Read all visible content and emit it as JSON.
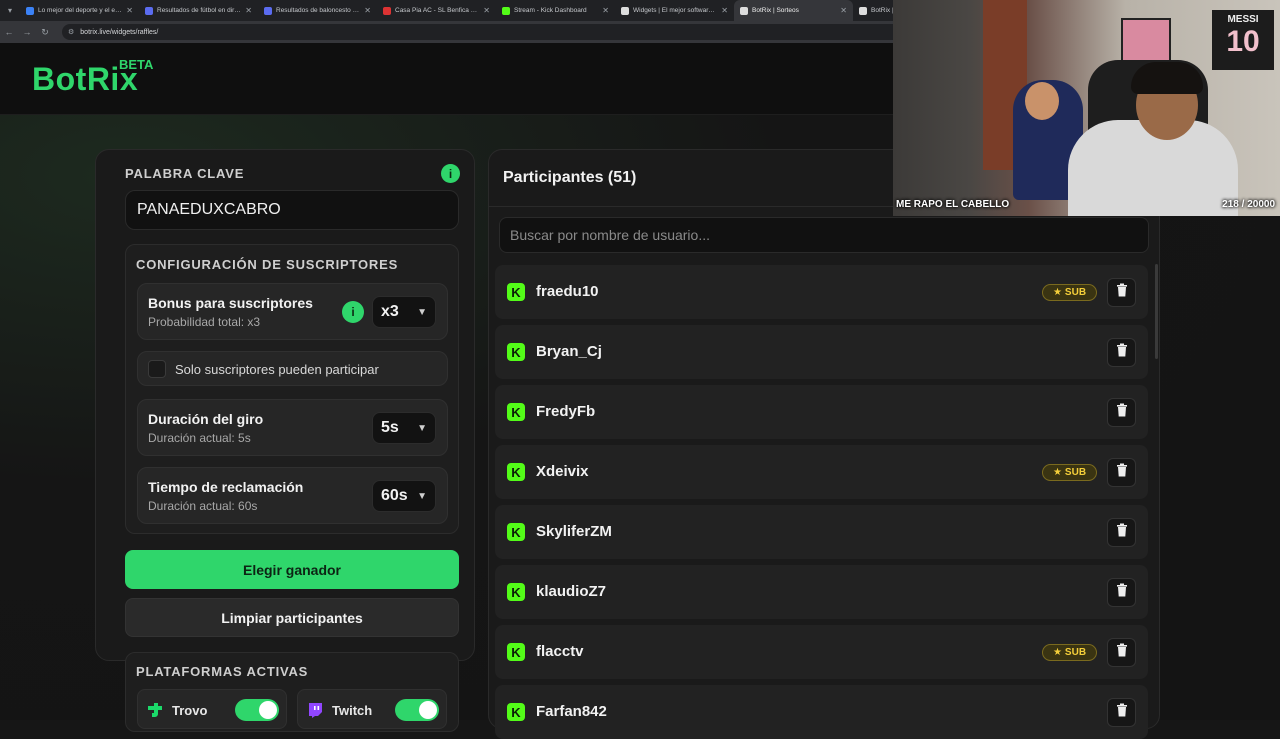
{
  "browser": {
    "tabs": [
      {
        "title": "Lo mejor del deporte y el entre",
        "color": "#3b82f6"
      },
      {
        "title": "Resultados de fútbol en direct",
        "color": "#5b6cf0"
      },
      {
        "title": "Resultados de baloncesto en di",
        "color": "#5b6cf0"
      },
      {
        "title": "Casa Pia AC - SL Benfica Cuota",
        "color": "#d33"
      },
      {
        "title": "Stream - Kick Dashboard",
        "color": "#53fc18"
      },
      {
        "title": "Widgets | El mejor software pa",
        "color": "#ddd"
      },
      {
        "title": "BotRix | Sorteos",
        "color": "#ddd"
      },
      {
        "title": "BotRix | S",
        "color": "#ddd"
      }
    ],
    "url": "botrix.live/widgets/raffles/"
  },
  "header": {
    "logo": "BotRix",
    "badge": "BETA"
  },
  "raffle": {
    "keyword_label": "PALABRA CLAVE",
    "keyword_value": "PANAEDUXCABRO",
    "subs_config_title": "CONFIGURACIÓN DE SUSCRIPTORES",
    "bonus_title": "Bonus para suscriptores",
    "bonus_sub": "Probabilidad total: x3",
    "bonus_value": "x3",
    "only_subs_label": "Solo suscriptores pueden participar",
    "spin_title": "Duración del giro",
    "spin_sub": "Duración actual: 5s",
    "spin_value": "5s",
    "claim_title": "Tiempo de reclamación",
    "claim_sub": "Duración actual: 60s",
    "claim_value": "60s",
    "pick_winner": "Elegir ganador",
    "clear": "Limpiar participantes",
    "platforms_title": "PLATAFORMAS ACTIVAS",
    "platforms": [
      {
        "name": "Trovo",
        "enabled": true,
        "color": "#1bd96a"
      },
      {
        "name": "Twitch",
        "enabled": true,
        "color": "#9146ff"
      }
    ]
  },
  "participants": {
    "title": "Participantes (51)",
    "search_placeholder": "Buscar por nombre de usuario...",
    "sub_badge": "SUB",
    "list": [
      {
        "name": "fraedu10",
        "sub": true
      },
      {
        "name": "Bryan_Cj",
        "sub": false
      },
      {
        "name": "FredyFb",
        "sub": false
      },
      {
        "name": "Xdeivix",
        "sub": true
      },
      {
        "name": "SkyliferZM",
        "sub": false
      },
      {
        "name": "klaudioZ7",
        "sub": false
      },
      {
        "name": "flacctv",
        "sub": true
      },
      {
        "name": "Farfan842",
        "sub": false
      }
    ]
  },
  "webcam": {
    "caption": "ME RAPO EL CABELLO",
    "counter": "218 / 20000",
    "poster_name": "MESSI",
    "poster_number": "10"
  },
  "colors": {
    "accent": "#2fd66b",
    "kick": "#53fc18",
    "sub": "#f5cf3a"
  }
}
